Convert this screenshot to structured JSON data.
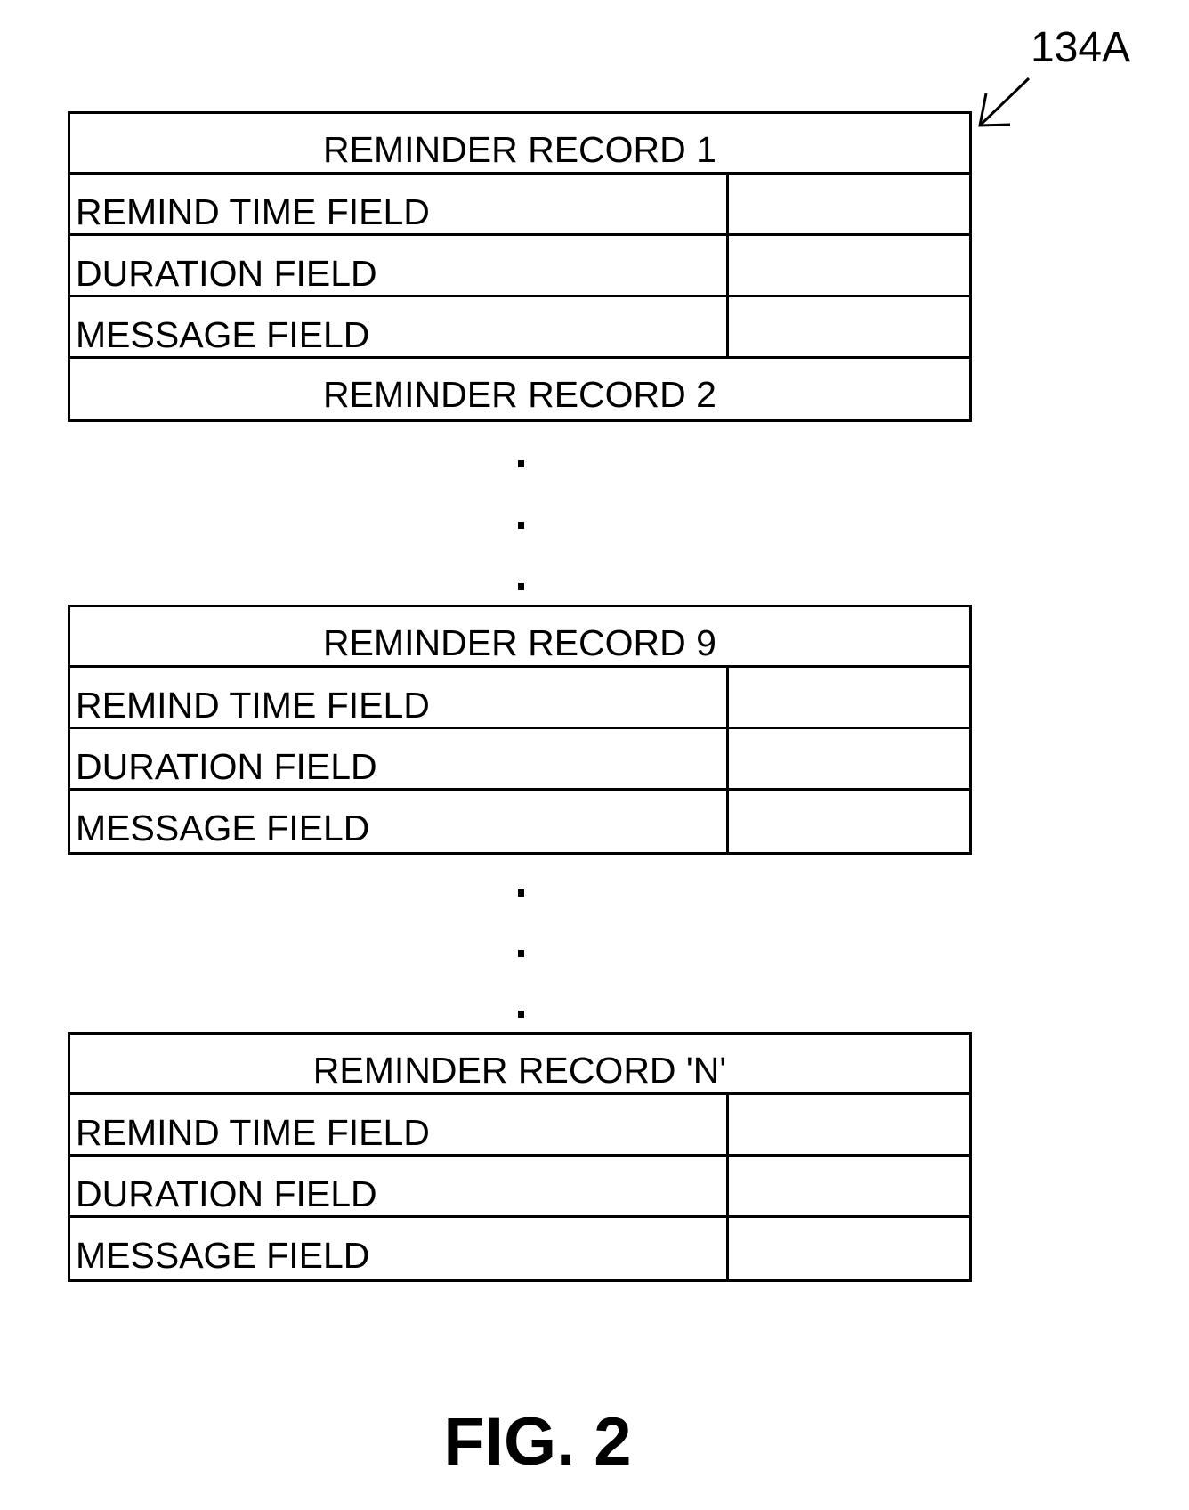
{
  "reference_label": "134A",
  "records": [
    {
      "title": "REMINDER RECORD 1",
      "fields": [
        {
          "label": "REMIND TIME FIELD",
          "value": ""
        },
        {
          "label": "DURATION FIELD",
          "value": ""
        },
        {
          "label": "MESSAGE FIELD",
          "value": ""
        }
      ]
    },
    {
      "title": "REMINDER RECORD 2"
    },
    {
      "title": "REMINDER RECORD 9",
      "fields": [
        {
          "label": "REMIND TIME FIELD",
          "value": ""
        },
        {
          "label": "DURATION FIELD",
          "value": ""
        },
        {
          "label": "MESSAGE FIELD",
          "value": ""
        }
      ]
    },
    {
      "title": "REMINDER RECORD 'N'",
      "fields": [
        {
          "label": "REMIND TIME FIELD",
          "value": ""
        },
        {
          "label": "DURATION FIELD",
          "value": ""
        },
        {
          "label": "MESSAGE FIELD",
          "value": ""
        }
      ]
    }
  ],
  "ellipsis_symbol": "⋮",
  "caption": "FIG. 2"
}
